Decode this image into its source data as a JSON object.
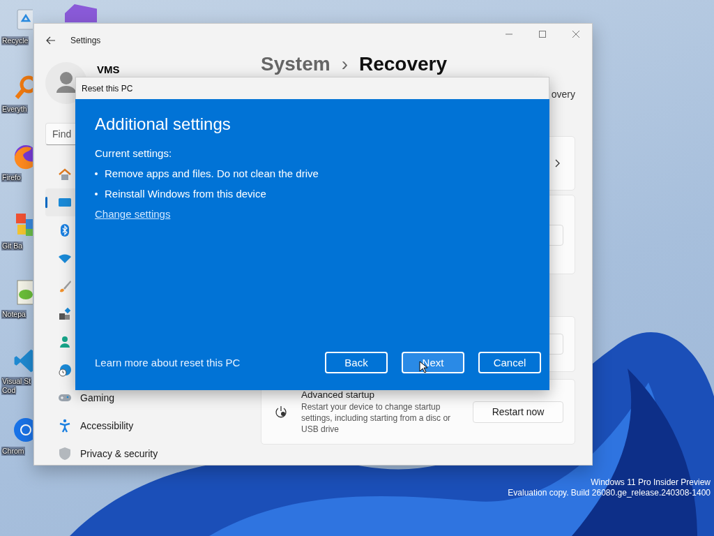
{
  "desktop_icons": [
    {
      "lines": [
        "Recycle"
      ]
    },
    {
      "lines": [
        "Everyth"
      ]
    },
    {
      "lines": [
        "Firefo"
      ]
    },
    {
      "lines": [
        "Git Ba"
      ]
    },
    {
      "lines": [
        "Notepa"
      ]
    },
    {
      "lines": [
        "Visual St",
        "Cod"
      ]
    },
    {
      "lines": [
        "Chrom"
      ]
    }
  ],
  "settings_window": {
    "title": "Settings",
    "user_name": "VMS",
    "search": {
      "placeholder": "Find"
    },
    "nav_items": [
      {
        "selected": false
      },
      {
        "selected": true
      },
      {
        "selected": false
      },
      {
        "selected": false
      },
      {
        "selected": false
      },
      {
        "selected": false
      },
      {
        "selected": false
      },
      {
        "selected": false
      },
      {
        "label": "Gaming",
        "selected": false
      },
      {
        "label": "Accessibility",
        "selected": false
      },
      {
        "label": "Privacy & security",
        "selected": false
      }
    ],
    "header": {
      "section": "System",
      "separator": "›",
      "page": "Recovery"
    },
    "subtitle": "overy",
    "advanced_startup": {
      "title": "Advanced startup",
      "description": "Restart your device to change startup settings, including starting from a disc or USB drive",
      "button": "Restart now"
    }
  },
  "dialog": {
    "title": "Reset this PC",
    "heading": "Additional settings",
    "current_label": "Current settings:",
    "bullets": [
      "Remove apps and files. Do not clean the drive",
      "Reinstall Windows from this device"
    ],
    "link": "Change settings",
    "learn_more": "Learn more about reset this PC",
    "buttons": [
      {
        "label": "Back",
        "hovered": false
      },
      {
        "label": "Next",
        "hovered": true
      },
      {
        "label": "Cancel",
        "hovered": false
      }
    ]
  },
  "watermark": [
    "Windows 11 Pro Insider Preview",
    "Evaluation copy. Build 26080.ge_release.240308-1400"
  ]
}
